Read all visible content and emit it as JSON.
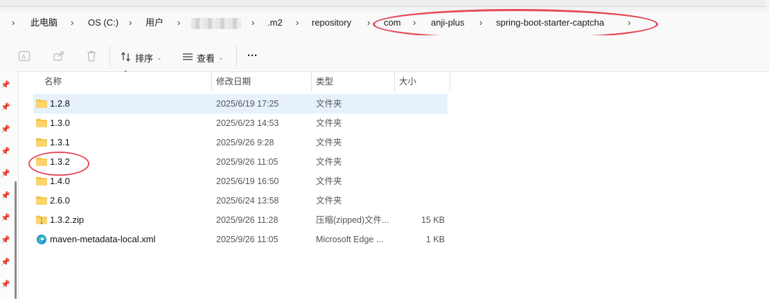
{
  "breadcrumb": {
    "items": [
      {
        "label": "此电脑"
      },
      {
        "label": "OS (C:)"
      },
      {
        "label": "用户"
      },
      {
        "label": ""
      },
      {
        "label": ".m2"
      },
      {
        "label": "repository"
      },
      {
        "label": "com"
      },
      {
        "label": "anji-plus"
      },
      {
        "label": "spring-boot-starter-captcha"
      }
    ]
  },
  "toolbar": {
    "sort_label": "排序",
    "view_label": "查看",
    "more_label": "···"
  },
  "columns": {
    "name": "名称",
    "date": "修改日期",
    "type": "类型",
    "size": "大小"
  },
  "files": [
    {
      "name": "1.2.8",
      "date": "2025/6/19 17:25",
      "type": "文件夹",
      "size": "",
      "icon": "folder-icon",
      "selected": true
    },
    {
      "name": "1.3.0",
      "date": "2025/6/23 14:53",
      "type": "文件夹",
      "size": "",
      "icon": "folder-icon"
    },
    {
      "name": "1.3.1",
      "date": "2025/9/26 9:28",
      "type": "文件夹",
      "size": "",
      "icon": "folder-icon"
    },
    {
      "name": "1.3.2",
      "date": "2025/9/26 11:05",
      "type": "文件夹",
      "size": "",
      "icon": "folder-icon"
    },
    {
      "name": "1.4.0",
      "date": "2025/6/19 16:50",
      "type": "文件夹",
      "size": "",
      "icon": "folder-icon"
    },
    {
      "name": "2.6.0",
      "date": "2025/6/24 13:58",
      "type": "文件夹",
      "size": "",
      "icon": "folder-icon"
    },
    {
      "name": "1.3.2.zip",
      "date": "2025/9/26 11:28",
      "type": "压缩(zipped)文件...",
      "size": "15 KB",
      "icon": "zip-folder-icon"
    },
    {
      "name": "maven-metadata-local.xml",
      "date": "2025/9/26 11:05",
      "type": "Microsoft Edge ...",
      "size": "1 KB",
      "icon": "edge-icon"
    }
  ],
  "colors": {
    "selection": "#e6f1fb",
    "annotation": "#e64b5a",
    "folder": "#f8c545"
  }
}
